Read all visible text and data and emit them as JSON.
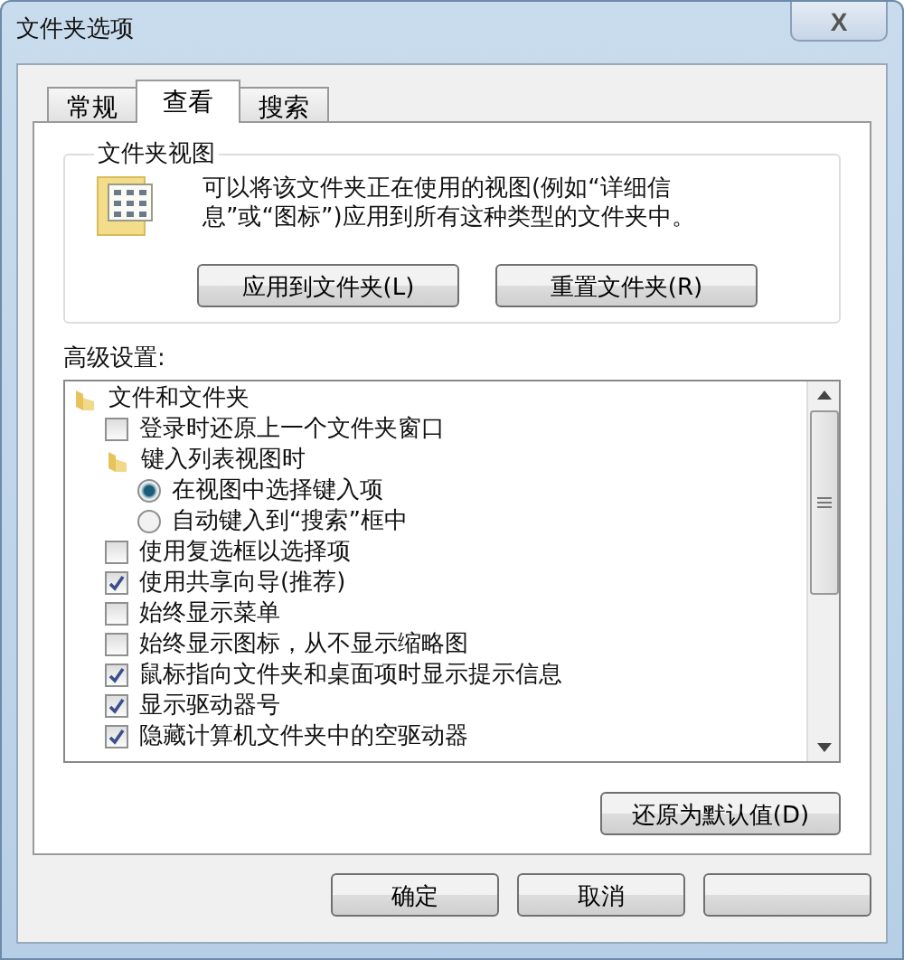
{
  "window": {
    "title": "文件夹选项",
    "close": "X"
  },
  "tabs": [
    {
      "label": "常规",
      "selected": false
    },
    {
      "label": "查看",
      "selected": true
    },
    {
      "label": "搜索",
      "selected": false
    }
  ],
  "folder_views": {
    "title": "文件夹视图",
    "description": "可以将该文件夹正在使用的视图(例如“详细信息”或“图标”)应用到所有这种类型的文件夹中。",
    "buttons": [
      "应用到文件夹(L)",
      "重置文件夹(R)"
    ]
  },
  "advanced": {
    "label": "高级设置:",
    "items": [
      {
        "kind": "folder",
        "label": "文件和文件夹",
        "children": [
          {
            "kind": "checkbox",
            "label": "登录时还原上一个文件夹窗口",
            "checked": false
          },
          {
            "kind": "folder",
            "label": "键入列表视图时",
            "children": [
              {
                "kind": "radio",
                "label": "在视图中选择键入项",
                "selected": true
              },
              {
                "kind": "radio",
                "label": "自动键入到“搜索”框中",
                "selected": false
              }
            ]
          },
          {
            "kind": "checkbox",
            "label": "使用复选框以选择项",
            "checked": false
          },
          {
            "kind": "checkbox",
            "label": "使用共享向导(推荐)",
            "checked": true
          },
          {
            "kind": "checkbox",
            "label": "始终显示菜单",
            "checked": false
          },
          {
            "kind": "checkbox",
            "label": "始终显示图标，从不显示缩略图",
            "checked": false
          },
          {
            "kind": "checkbox",
            "label": "鼠标指向文件夹和桌面项时显示提示信息",
            "checked": true
          },
          {
            "kind": "checkbox",
            "label": "显示驱动器号",
            "checked": true
          },
          {
            "kind": "checkbox",
            "label": "隐藏计算机文件夹中的空驱动器",
            "checked": true
          }
        ]
      }
    ],
    "restore_button": "还原为默认值(D)"
  },
  "buttons": [
    {
      "label": "确定"
    },
    {
      "label": "取消"
    }
  ]
}
